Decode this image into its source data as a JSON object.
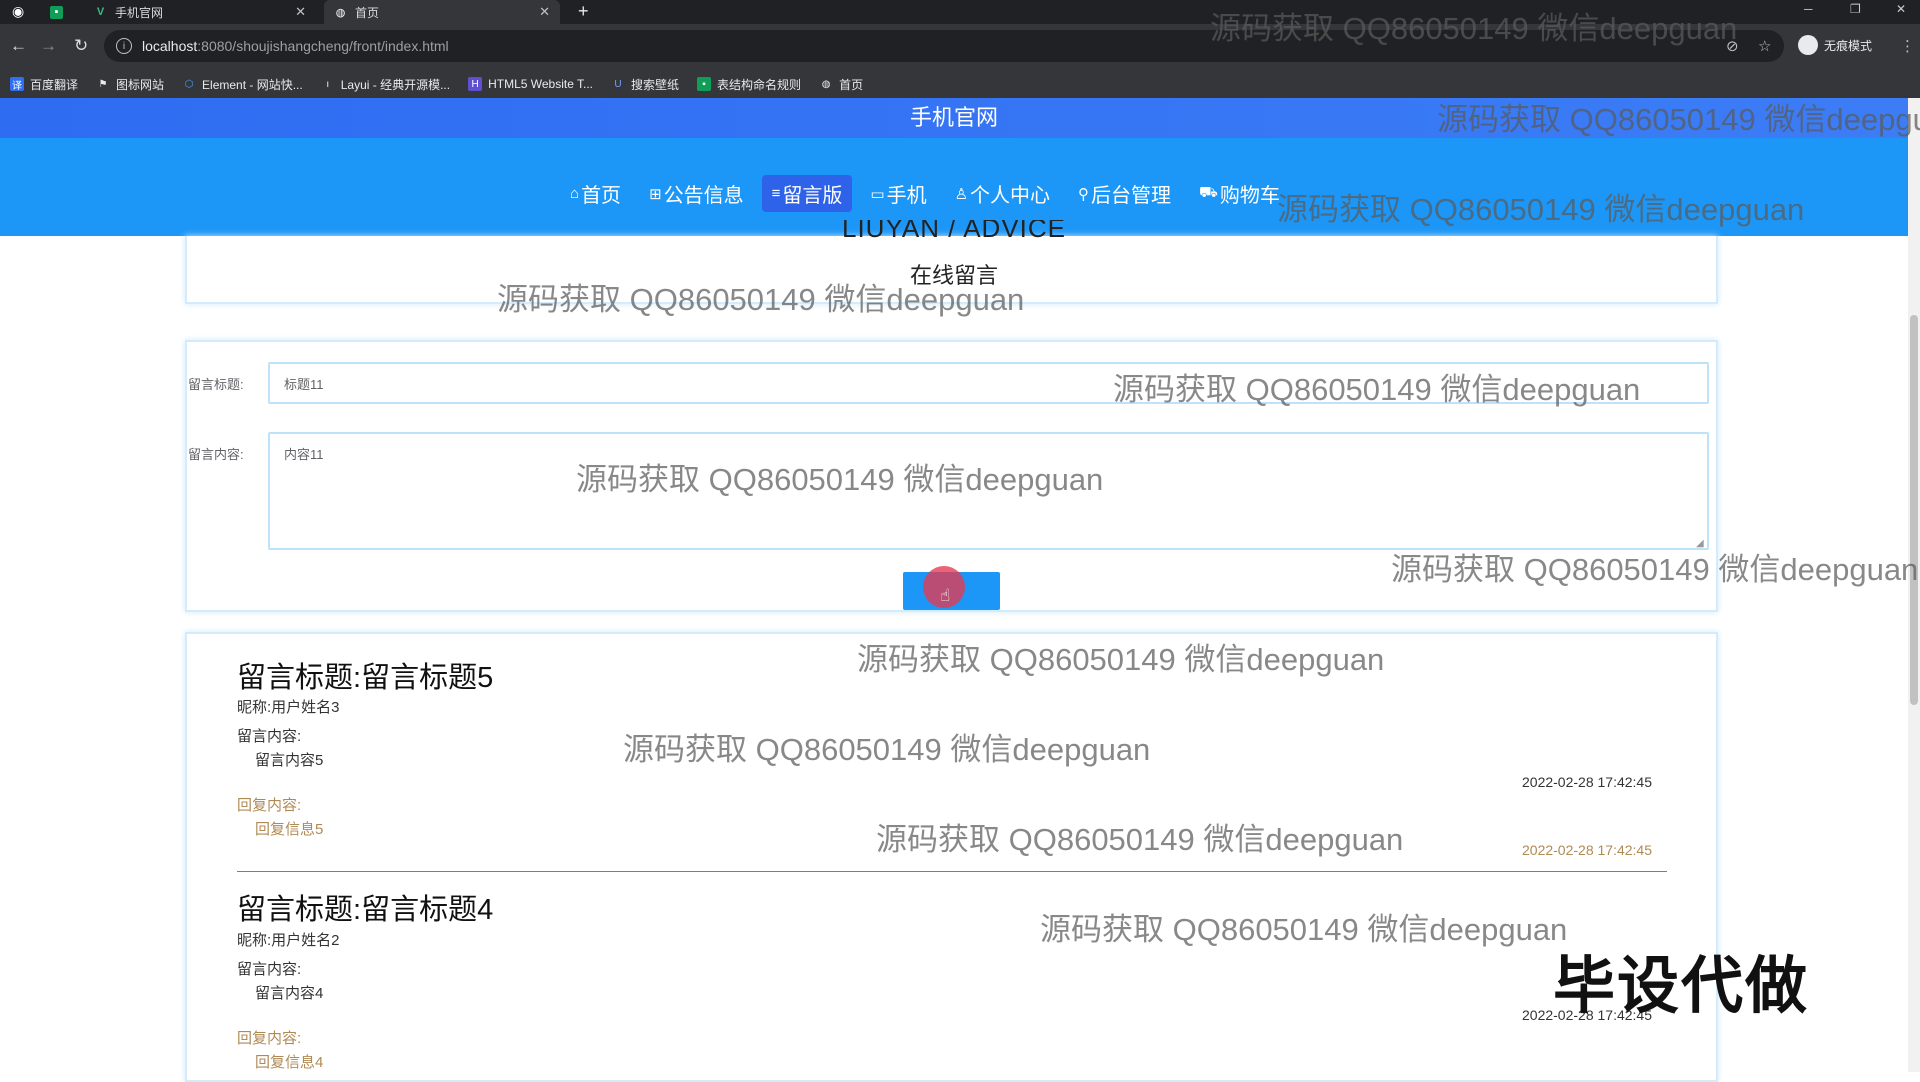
{
  "browser": {
    "tabs": [
      {
        "label": "",
        "icon": "green-sheet-icon"
      },
      {
        "label": "手机官网",
        "icon": "vue-icon"
      },
      {
        "label": "首页",
        "icon": "globe-icon"
      }
    ],
    "new_tab": "+",
    "url_host": "localhost",
    "url_path": ":8080/shoujishangcheng/front/index.html",
    "incognito_label": "无痕模式",
    "bookmarks": [
      {
        "label": "百度翻译",
        "color": "#2f6ff0"
      },
      {
        "label": "图标网站",
        "color": "#555555"
      },
      {
        "label": "Element - 网站快...",
        "color": "#409eff"
      },
      {
        "label": "Layui - 经典开源模...",
        "color": "#555555"
      },
      {
        "label": "HTML5 Website T...",
        "color": "#5f4fd1"
      },
      {
        "label": "搜索壁纸",
        "color": "#2f6ff0"
      },
      {
        "label": "表结构命名规则",
        "color": "#0f9d58"
      },
      {
        "label": "首页",
        "color": "#777777"
      }
    ]
  },
  "site": {
    "title": "手机官网",
    "nav": [
      {
        "label": "首页",
        "icon": "home-icon",
        "glyph": "⌂"
      },
      {
        "label": "公告信息",
        "icon": "notice-icon",
        "glyph": "⊞"
      },
      {
        "label": "留言版",
        "icon": "message-icon",
        "glyph": "≡"
      },
      {
        "label": "手机",
        "icon": "phone-icon",
        "glyph": "▭"
      },
      {
        "label": "个人中心",
        "icon": "user-icon",
        "glyph": "♙"
      },
      {
        "label": "后台管理",
        "icon": "link-icon",
        "glyph": "⚲"
      },
      {
        "label": "购物车",
        "icon": "cart-icon",
        "glyph": "⛟"
      }
    ],
    "active_nav": "留言版"
  },
  "page": {
    "title_en": "LIUYAN / ADVICE",
    "title": "在线留言"
  },
  "form": {
    "title_label": "留言标题:",
    "title_value": "标题11",
    "content_label": "留言内容:",
    "content_value": "内容11",
    "submit_label": ""
  },
  "messages": [
    {
      "title_prefix": "留言标题:",
      "title": "留言标题5",
      "nickname": "昵称:用户姓名3",
      "content_label": "留言内容:",
      "content": "留言内容5",
      "date": "2022-02-28 17:42:45",
      "reply_label": "回复内容:",
      "reply": "回复信息5",
      "reply_date": "2022-02-28 17:42:45"
    },
    {
      "title_prefix": "留言标题:",
      "title": "留言标题4",
      "nickname": "昵称:用户姓名2",
      "content_label": "留言内容:",
      "content": "留言内容4",
      "date": "2022-02-28 17:42:45",
      "reply_label": "回复内容:",
      "reply": "回复信息4"
    }
  ],
  "watermark": "源码获取 QQ86050149 微信deepguan",
  "stamp": "毕设代做"
}
